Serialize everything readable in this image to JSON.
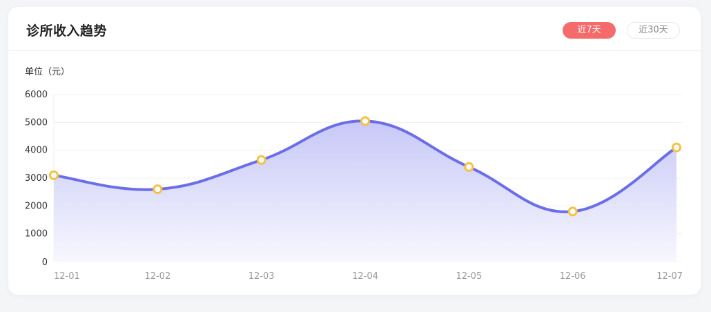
{
  "header": {
    "title": "诊所收入趋势",
    "tabs": [
      {
        "label": "近7天",
        "active": true
      },
      {
        "label": "近30天",
        "active": false
      }
    ]
  },
  "unit_label": "单位（元）",
  "colors": {
    "line": "#6b6ee8",
    "area_top": "#c7c8f7",
    "area_bottom": "#f7f7fe",
    "point_stroke": "#f6c142",
    "tab_active": "#f56a6a",
    "grid": "#f0f0f0"
  },
  "chart_data": {
    "type": "area",
    "categories": [
      "12-01",
      "12-02",
      "12-03",
      "12-04",
      "12-05",
      "12-06",
      "12-07"
    ],
    "values": [
      3100,
      2600,
      3650,
      5050,
      3400,
      1800,
      4100
    ],
    "y_ticks": [
      6000,
      5000,
      4000,
      3000,
      2000,
      1000,
      0
    ],
    "ylim": [
      0,
      6000
    ],
    "title": "诊所收入趋势",
    "ylabel": "单位（元）",
    "xlabel": "",
    "grid": true,
    "smooth": true
  }
}
